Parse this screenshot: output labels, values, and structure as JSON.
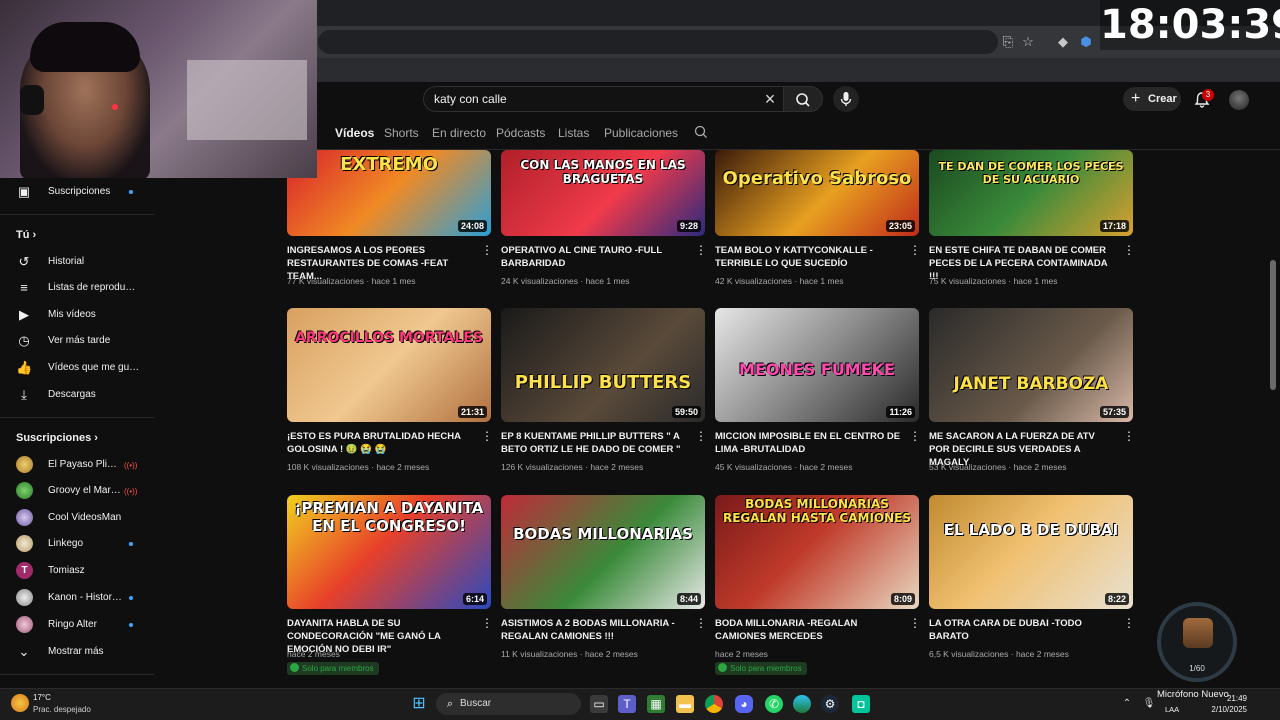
{
  "clock": "18:03:39",
  "search": {
    "value": "katy con calle"
  },
  "header": {
    "create_label": "Crear",
    "notif_count": "3"
  },
  "tabs": [
    "Vídeos",
    "Shorts",
    "En directo",
    "Pódcasts",
    "Listas",
    "Publicaciones"
  ],
  "sidebar": {
    "subscriptions_item": "Suscripciones",
    "you_heading": "Tú",
    "you_items": [
      {
        "label": "Historial",
        "icon": "history-icon"
      },
      {
        "label": "Listas de reproducc...",
        "icon": "playlist-icon"
      },
      {
        "label": "Mis vídeos",
        "icon": "my-videos-icon"
      },
      {
        "label": "Ver más tarde",
        "icon": "watch-later-icon"
      },
      {
        "label": "Vídeos que me gus...",
        "icon": "like-icon"
      },
      {
        "label": "Descargas",
        "icon": "download-icon"
      }
    ],
    "subs_heading": "Suscripciones",
    "channels": [
      {
        "name": "El Payaso Plim P...",
        "status": "live"
      },
      {
        "name": "Groovy el Marcia...",
        "status": "live"
      },
      {
        "name": "Cool VideosMan",
        "status": ""
      },
      {
        "name": "Linkego",
        "status": "dot"
      },
      {
        "name": "Tomiasz",
        "status": ""
      },
      {
        "name": "Kanon - Historia...",
        "status": "dot"
      },
      {
        "name": "Ringo Alter",
        "status": "dot"
      }
    ],
    "show_more": "Mostrar más"
  },
  "videos": [
    {
      "title": "INGRESAMOS A LOS PEORES RESTAURANTES DE COMAS -FEAT TEAM...",
      "views": "77 K visualizaciones",
      "age": "hace 1 mes",
      "duration": "24:08",
      "thumb_text": "EXTREMO",
      "members": ""
    },
    {
      "title": "OPERATIVO AL CINE TAURO -FULL BARBARIDAD",
      "views": "24 K visualizaciones",
      "age": "hace 1 mes",
      "duration": "9:28",
      "thumb_text": "CON LAS MANOS EN LAS BRAGUETAS",
      "members": ""
    },
    {
      "title": "TEAM BOLO Y KATTYCONKALLE - TERRIBLE LO QUE SUCEDÍO",
      "views": "42 K visualizaciones",
      "age": "hace 1 mes",
      "duration": "23:05",
      "thumb_text": "Operativo Sabroso",
      "members": ""
    },
    {
      "title": "EN ESTE CHIFA TE DABAN DE COMER PECES DE LA PECERA CONTAMINADA !!!",
      "views": "75 K visualizaciones",
      "age": "hace 1 mes",
      "duration": "17:18",
      "thumb_text": "TE DAN DE COMER LOS PECES DE SU ACUARIO",
      "members": ""
    },
    {
      "title": "¡ESTO ES PURA BRUTALIDAD HECHA GOLOSINA ! 🤢 😭 😭",
      "views": "108 K visualizaciones",
      "age": "hace 2 meses",
      "duration": "21:31",
      "thumb_text": "ARROCILLOS MORTALES",
      "members": ""
    },
    {
      "title": "EP 8 KUENTAME PHILLIP BUTTERS \" A BETO ORTIZ LE HE DADO DE COMER \"",
      "views": "126 K visualizaciones",
      "age": "hace 2 meses",
      "duration": "59:50",
      "thumb_text": "PHILLIP BUTTERS",
      "members": ""
    },
    {
      "title": "MICCION IMPOSIBLE EN EL CENTRO DE LIMA -BRUTALIDAD",
      "views": "45 K visualizaciones",
      "age": "hace 2 meses",
      "duration": "11:26",
      "thumb_text": "MEONES FUMEKE",
      "members": ""
    },
    {
      "title": "ME SACARON A LA FUERZA DE ATV POR DECIRLE SUS VERDADES A MAGALY",
      "views": "53 K visualizaciones",
      "age": "hace 2 meses",
      "duration": "57:35",
      "thumb_text": "JANET BARBOZA",
      "members": ""
    },
    {
      "title": "DAYANITA HABLA DE SU CONDECORACIÓN \"ME GANÓ LA EMOCIÓN NO DEBI IR\"",
      "views": "",
      "age": "hace 2 meses",
      "duration": "6:14",
      "thumb_text": "¡PREMIAN A DAYANITA EN EL CONGRESO!",
      "members": "Solo para miembros"
    },
    {
      "title": "ASISTIMOS A 2 BODAS MILLONARIA - REGALAN CAMIONES !!!",
      "views": "11 K visualizaciones",
      "age": "hace 2 meses",
      "duration": "8:44",
      "thumb_text": "BODAS MILLONARIAS",
      "members": ""
    },
    {
      "title": "BODA MILLONARIA -REGALAN CAMIONES MERCEDES",
      "views": "",
      "age": "hace 2 meses",
      "duration": "8:09",
      "thumb_text": "BODAS MILLONARIAS REGALAN HASTA CAMIONES",
      "members": "Solo para miembros"
    },
    {
      "title": "LA OTRA CARA DE DUBAI -TODO BARATO",
      "views": "6,5 K visualizaciones",
      "age": "hace 2 meses",
      "duration": "8:22",
      "thumb_text": "EL LADO B DE DUBAI",
      "members": ""
    }
  ],
  "loot": {
    "count": "1/60"
  },
  "taskbar": {
    "weather_temp": "17°C",
    "weather_desc": "Prac. despejado",
    "search_label": "Buscar",
    "mic_notice": "Micrófono Nuevo",
    "time": "21:49",
    "date": "2/10/2025",
    "lang": "LAA"
  }
}
